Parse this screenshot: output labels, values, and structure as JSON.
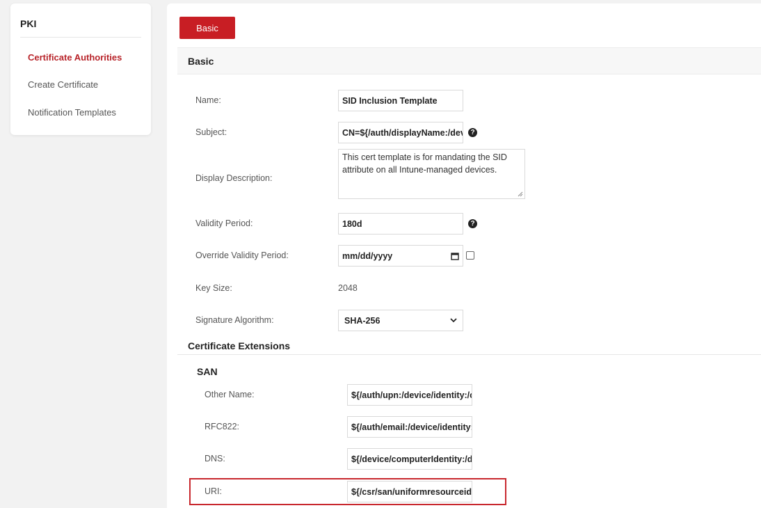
{
  "sidebar": {
    "title": "PKI",
    "items": [
      {
        "label": "Certificate Authorities",
        "active": true
      },
      {
        "label": "Create Certificate",
        "active": false
      },
      {
        "label": "Notification Templates",
        "active": false
      }
    ]
  },
  "tabs": {
    "basic_label": "Basic"
  },
  "section": {
    "basic_title": "Basic"
  },
  "form": {
    "name_label": "Name:",
    "name_value": "SID Inclusion Template",
    "subject_label": "Subject:",
    "subject_value": "CN=${/auth/displayName:/dev",
    "description_label": "Display Description:",
    "description_value": "This cert template is for mandating the SID attribute on all Intune-managed devices.",
    "validity_label": "Validity Period:",
    "validity_value": "180d",
    "override_label": "Override Validity Period:",
    "override_placeholder": "mm/dd/yyyy",
    "keysize_label": "Key Size:",
    "keysize_value": "2048",
    "sigalg_label": "Signature Algorithm:",
    "sigalg_value": "SHA-256"
  },
  "extensions": {
    "title": "Certificate Extensions",
    "san_title": "SAN",
    "other_name_label": "Other Name:",
    "other_name_value": "${/auth/upn:/device/identity:/c",
    "rfc822_label": "RFC822:",
    "rfc822_value": "${/auth/email:/device/identity:",
    "dns_label": "DNS:",
    "dns_value": "${/device/computerIdentity:/d",
    "uri_label": "URI:",
    "uri_value": "${/csr/san/uniformresourceide"
  },
  "icons": {
    "help": "?"
  },
  "colors": {
    "accent": "#c81e24",
    "highlight": "#c8272d",
    "active_nav": "#b8242a"
  }
}
